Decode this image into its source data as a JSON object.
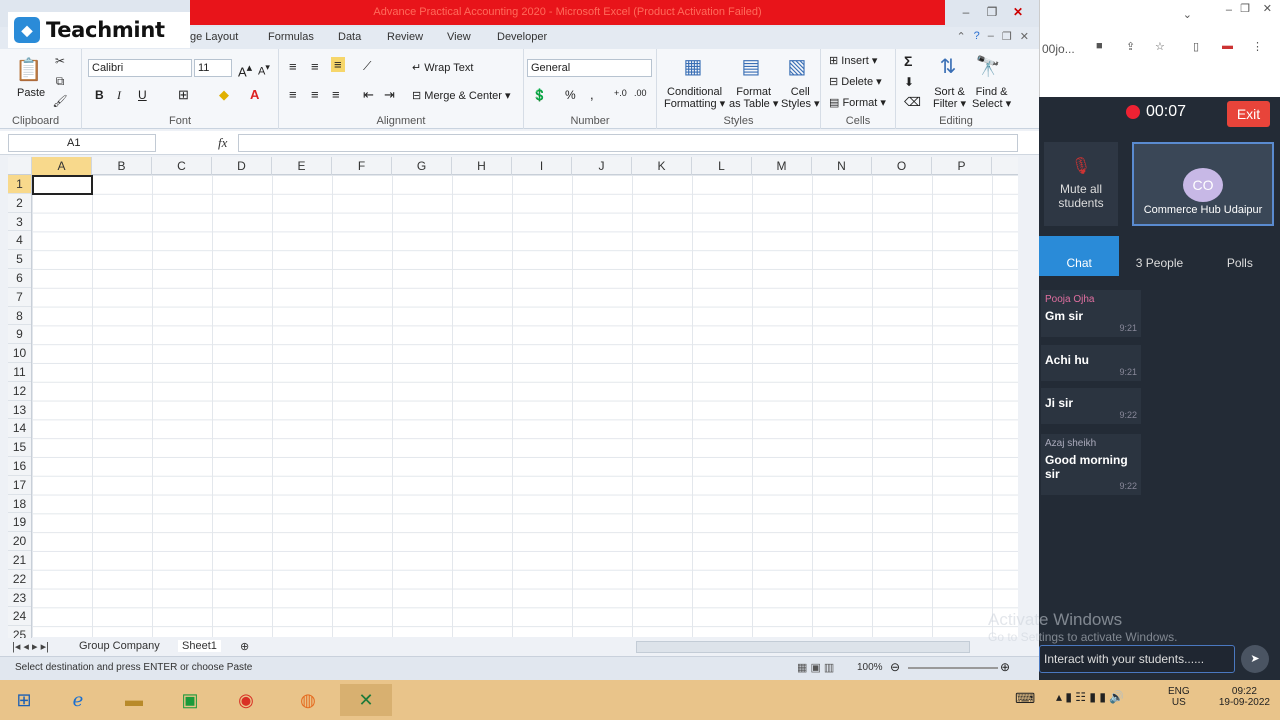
{
  "excel": {
    "window_title": "Advance Practical Accounting  2020 - Microsoft Excel (Product Activation Failed)",
    "tabs": [
      "ge Layout",
      "Formulas",
      "Data",
      "Review",
      "View",
      "Developer"
    ],
    "clipboard": {
      "paste": "Paste",
      "label": "Clipboard"
    },
    "font": {
      "name": "Calibri",
      "size": "11",
      "label": "Font",
      "bold": "B",
      "italic": "I",
      "underline": "U"
    },
    "alignment": {
      "wrap": "Wrap Text",
      "merge": "Merge & Center",
      "label": "Alignment"
    },
    "number": {
      "format": "General",
      "percent": "%",
      "comma": ",",
      "label": "Number"
    },
    "styles": {
      "conditional": "Conditional",
      "formatting": "Formatting",
      "format_as": "Format",
      "as_table": "as Table",
      "cell": "Cell",
      "cell_styles": "Styles",
      "label": "Styles"
    },
    "cells": {
      "insert": "Insert",
      "delete": "Delete",
      "format": "Format",
      "label": "Cells"
    },
    "editing": {
      "sort": "Sort &",
      "filter": "Filter",
      "find": "Find &",
      "select": "Select",
      "label": "Editing",
      "sigma": "Σ"
    },
    "namebox": "A1",
    "fx": "fx",
    "columns": [
      "A",
      "B",
      "C",
      "D",
      "E",
      "F",
      "G",
      "H",
      "I",
      "J",
      "K",
      "L",
      "M",
      "N",
      "O",
      "P"
    ],
    "rows": [
      "1",
      "2",
      "3",
      "4",
      "5",
      "6",
      "7",
      "8",
      "9",
      "10",
      "11",
      "12",
      "13",
      "14",
      "15",
      "16",
      "17",
      "18",
      "19",
      "20",
      "21",
      "22",
      "23",
      "24",
      "25"
    ],
    "sheets": [
      "Group Company",
      "Sheet1"
    ],
    "status": "Select destination and press ENTER or choose Paste",
    "zoom": "100%"
  },
  "brand": {
    "name": "Teachmint"
  },
  "browser": {
    "tab_fragment": "00jo..."
  },
  "side": {
    "timer": "00:07",
    "exit": "Exit",
    "mute": "Mute all students",
    "avatar": "CO",
    "hub_name": "Commerce Hub Udaipur",
    "tabs": [
      "Chat",
      "3 People",
      "Polls"
    ],
    "messages": [
      {
        "sender": "Pooja Ojha",
        "text": "Gm sir",
        "time": "9:21"
      },
      {
        "sender": "",
        "text": "Achi hu",
        "time": "9:21"
      },
      {
        "sender": "",
        "text": "Ji sir",
        "time": "9:22"
      },
      {
        "sender": "Azaj sheikh",
        "text": "Good morning sir",
        "time": "9:22"
      }
    ],
    "placeholder": "Interact with your students......",
    "activate": "Activate Windows",
    "activate_sub": "Go to Settings to activate Windows."
  },
  "taskbar": {
    "lang": "ENG",
    "region": "US",
    "time": "09:22",
    "date": "19-09-2022"
  },
  "colors": {
    "brand_blue": "#2a8bd8",
    "exit_red": "#e8443a",
    "title_red": "#e8141a"
  }
}
